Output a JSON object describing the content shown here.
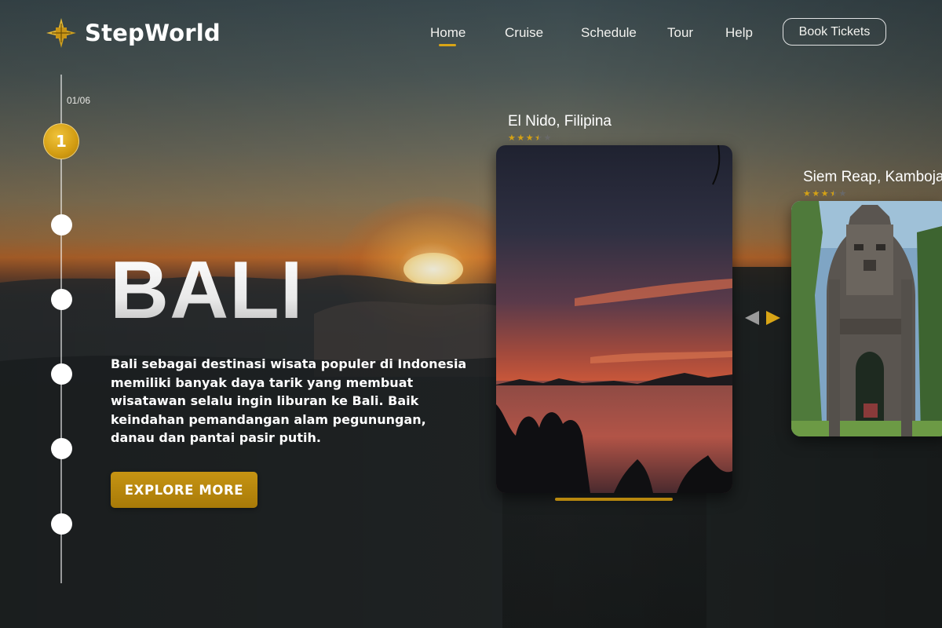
{
  "brand": {
    "name": "StepWorld",
    "logo_icon": "compass-star-icon",
    "accent_color": "#d29c12"
  },
  "nav": {
    "items": [
      {
        "label": "Home",
        "active": true
      },
      {
        "label": "Cruise",
        "active": false
      },
      {
        "label": "Schedule",
        "active": false
      },
      {
        "label": "Tour",
        "active": false
      },
      {
        "label": "Help",
        "active": false
      }
    ],
    "cta_label": "Book Tickets"
  },
  "timeline": {
    "counter": "01/06",
    "active_label": "1",
    "active_index": 1,
    "total": 6
  },
  "hero": {
    "title": "BALI",
    "description": "Bali sebagai destinasi wisata populer di Indonesia memiliki banyak daya tarik yang membuat wisatawan selalu ingin liburan ke Bali. Baik keindahan pemandangan alam pegunungan, danau dan pantai pasir putih.",
    "button_label": "EXPLORE MORE"
  },
  "destinations": [
    {
      "name": "El Nido, Filipina",
      "rating": 3.5,
      "max_rating": 5
    },
    {
      "name": "Siem Reap, Kamboja",
      "rating": 3.5,
      "max_rating": 5
    }
  ],
  "carousel": {
    "prev_icon": "triangle-left-icon",
    "next_icon": "triangle-right-icon"
  },
  "colors": {
    "star_filled": "#d9a516",
    "star_empty": "#6b6b6b",
    "white": "#ffffff"
  }
}
